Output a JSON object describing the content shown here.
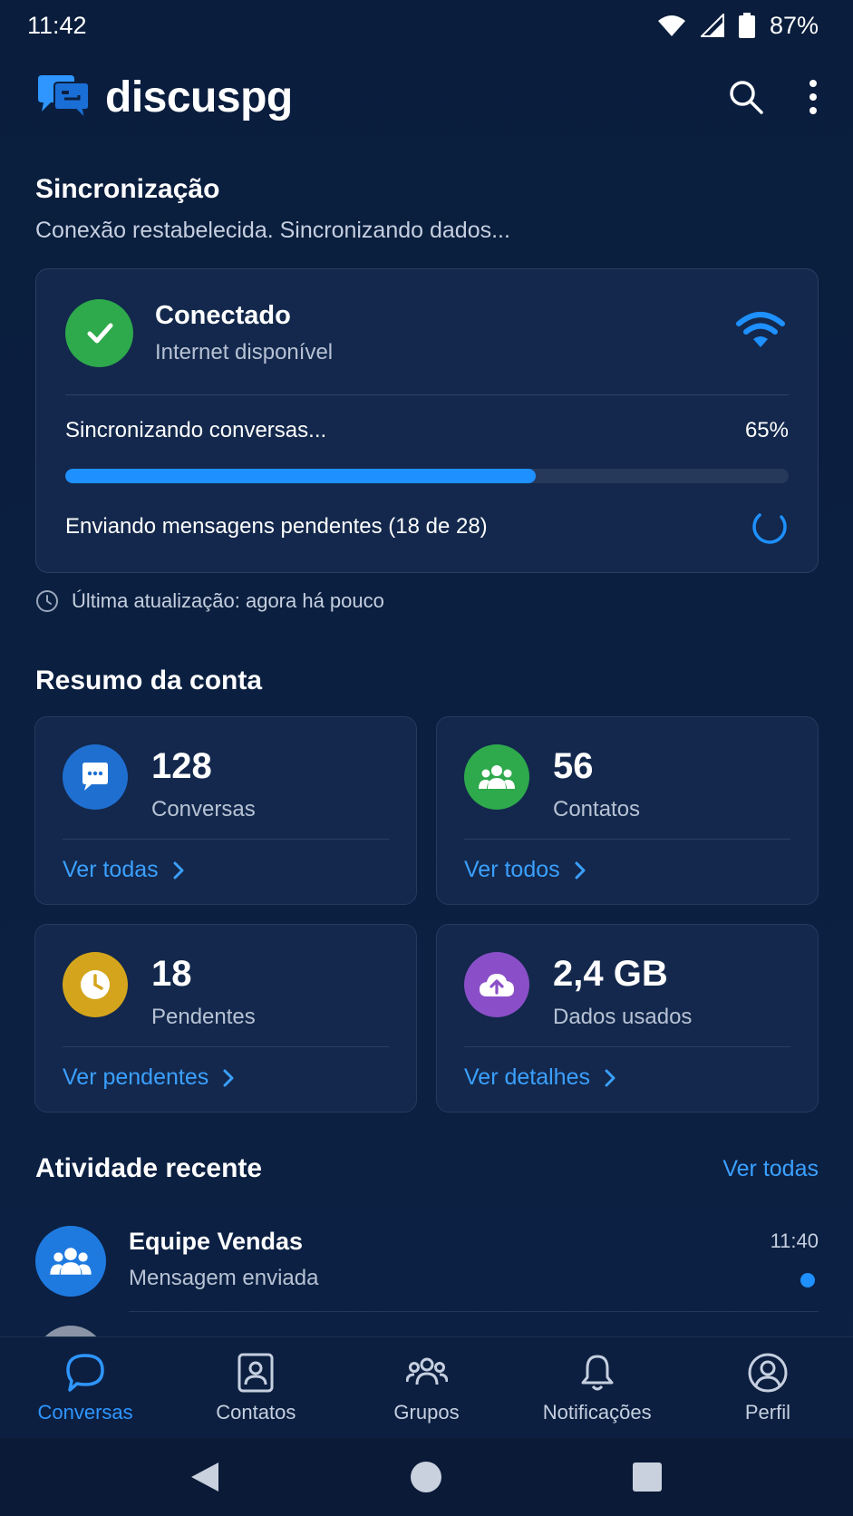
{
  "status_bar": {
    "time": "11:42",
    "battery": "87%"
  },
  "app": {
    "name": "discuspg"
  },
  "sync": {
    "title": "Sincronização",
    "subtitle": "Conexão restabelecida. Sincronizando dados...",
    "connection_title": "Conectado",
    "connection_sub": "Internet disponível",
    "progress_label": "Sincronizando conversas...",
    "progress_text": "65%",
    "progress_value": 0.65,
    "pending_text": "Enviando mensagens pendentes (18 de 28)",
    "last_update": "Última atualização: agora há pouco"
  },
  "summary": {
    "title": "Resumo da conta",
    "cards": [
      {
        "value": "128",
        "label": "Conversas",
        "link": "Ver todas",
        "icon": "chat-icon",
        "color": "#1f6fd1"
      },
      {
        "value": "56",
        "label": "Contatos",
        "link": "Ver todos",
        "icon": "contacts-group-icon",
        "color": "#2ea94c"
      },
      {
        "value": "18",
        "label": "Pendentes",
        "link": "Ver pendentes",
        "icon": "clock-icon",
        "color": "#d4a51c"
      },
      {
        "value": "2,4 GB",
        "label": "Dados usados",
        "link": "Ver detalhes",
        "icon": "cloud-upload-icon",
        "color": "#8a4fc8"
      }
    ]
  },
  "activity": {
    "title": "Atividade recente",
    "link": "Ver todas",
    "items": [
      {
        "name": "Equipe Vendas",
        "sub": "Mensagem enviada",
        "time": "11:40"
      }
    ]
  },
  "nav": {
    "items": [
      {
        "label": "Conversas",
        "icon": "chat-bubble-icon",
        "active": true
      },
      {
        "label": "Contatos",
        "icon": "contact-card-icon",
        "active": false
      },
      {
        "label": "Grupos",
        "icon": "groups-icon",
        "active": false
      },
      {
        "label": "Notificações",
        "icon": "bell-icon",
        "active": false
      },
      {
        "label": "Perfil",
        "icon": "profile-icon",
        "active": false
      }
    ]
  },
  "colors": {
    "accent": "#1e90ff",
    "success": "#2ea94c",
    "background": "#0b1f40",
    "card": "#13284c"
  }
}
